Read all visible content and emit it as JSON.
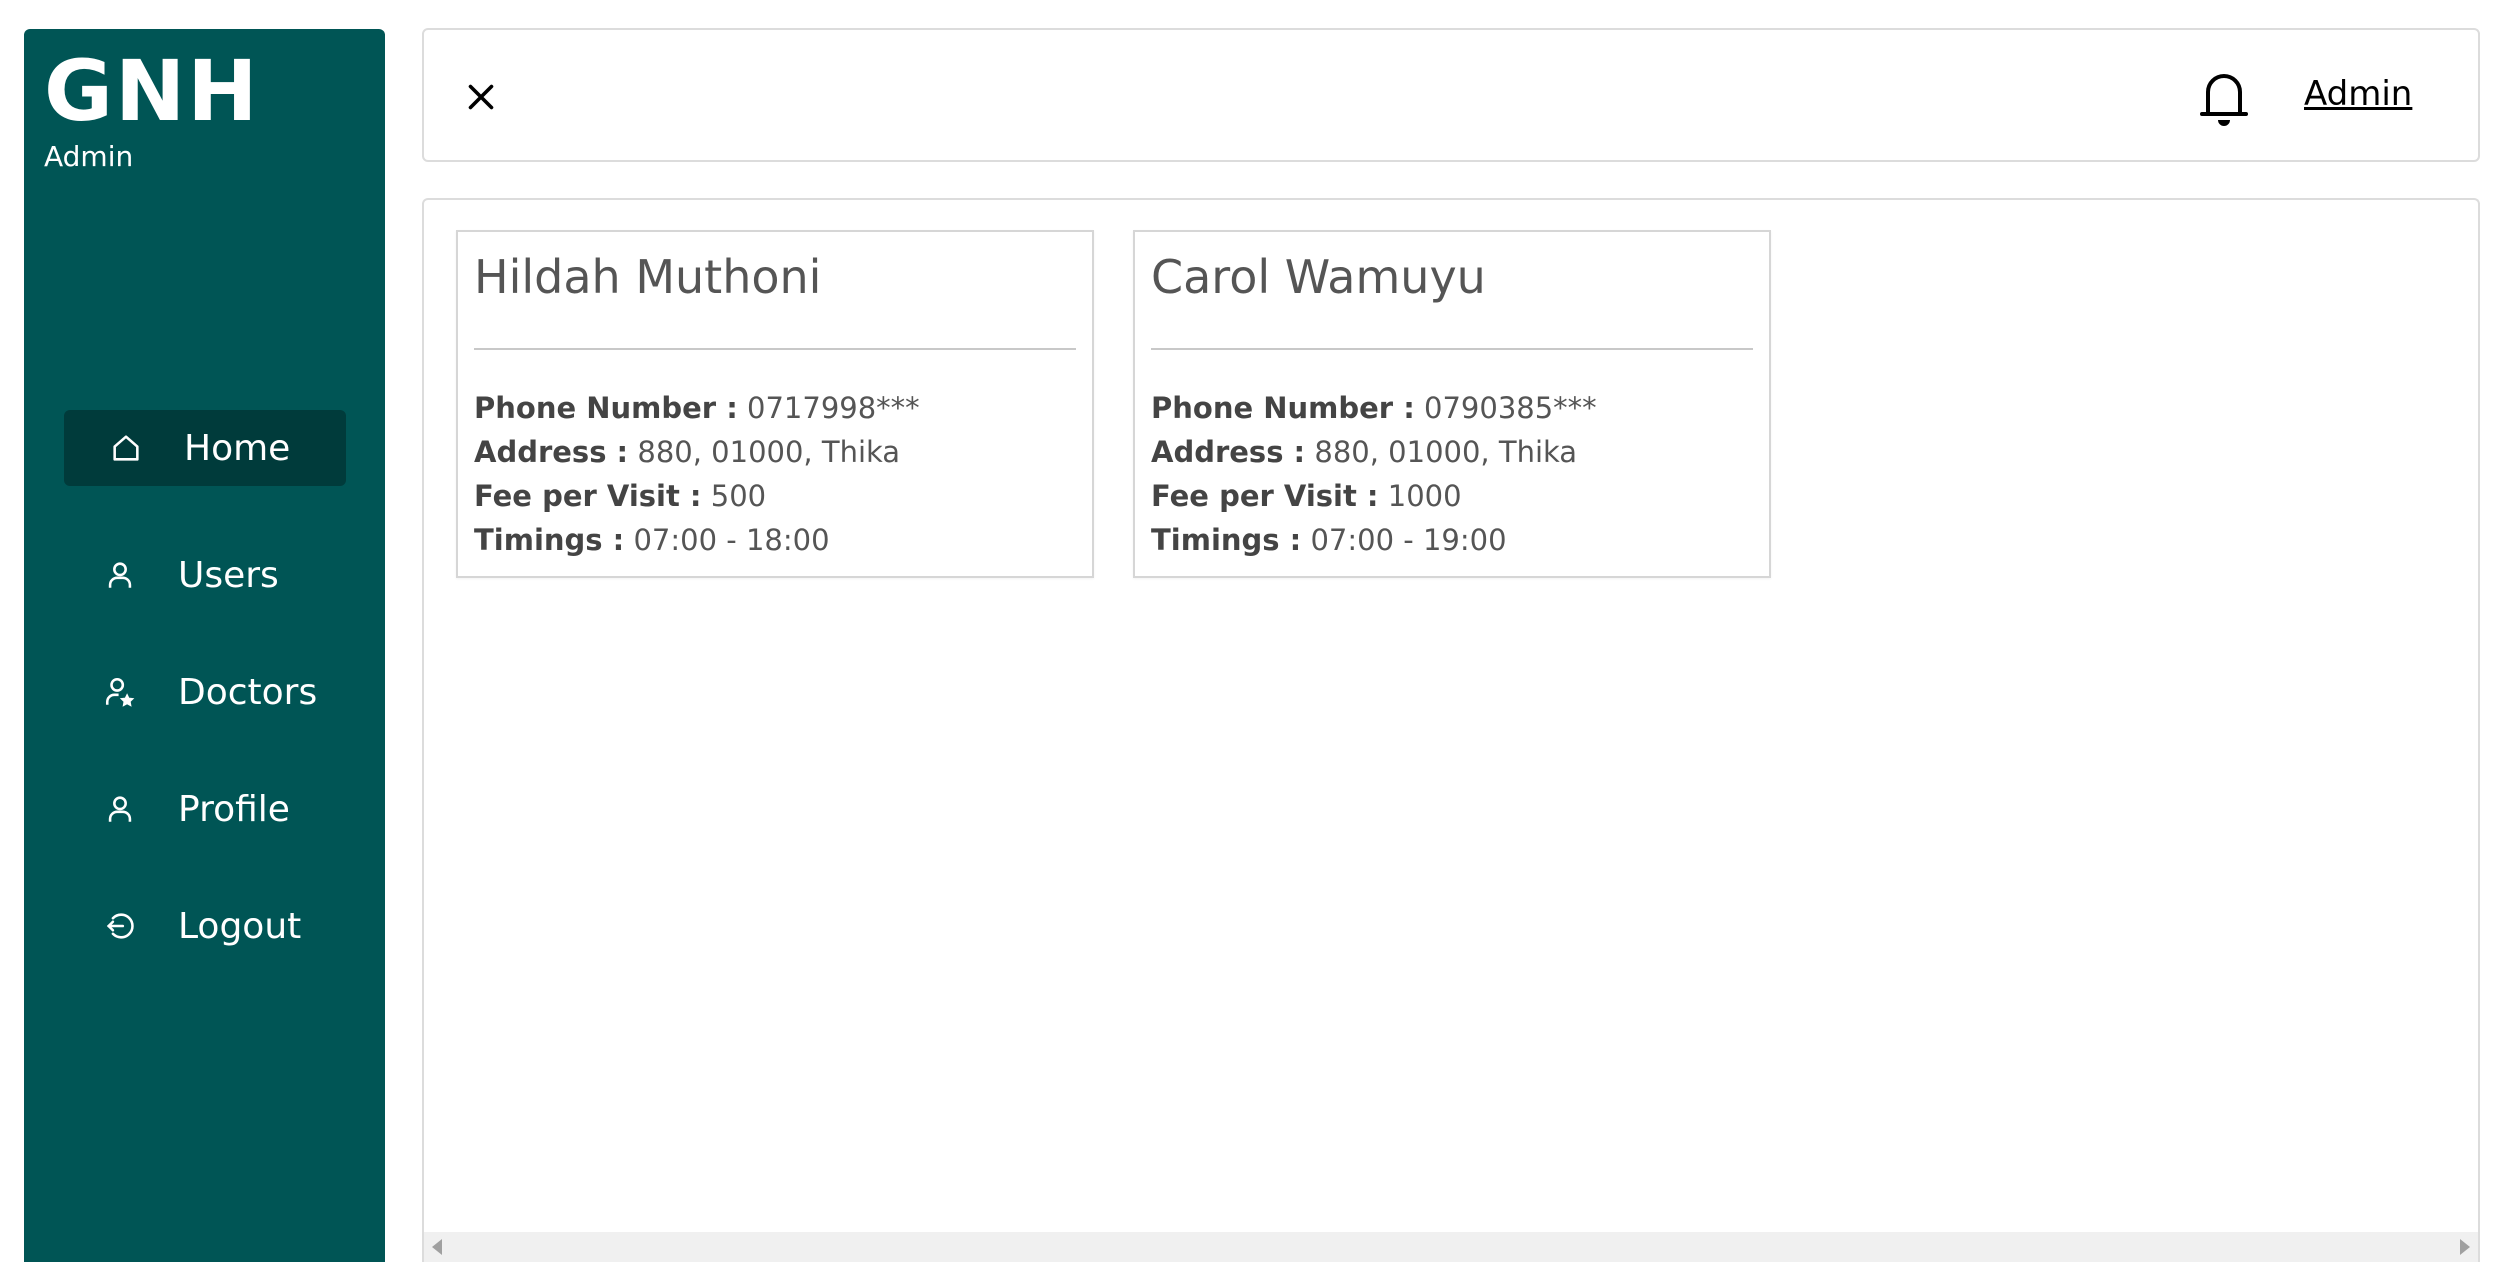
{
  "sidebar": {
    "brand": "GNH",
    "role": "Admin",
    "items": [
      {
        "label": "Home",
        "icon": "home-icon",
        "active": true
      },
      {
        "label": "Users",
        "icon": "user-icon",
        "active": false
      },
      {
        "label": "Doctors",
        "icon": "doctor-icon",
        "active": false
      },
      {
        "label": "Profile",
        "icon": "user-icon",
        "active": false
      },
      {
        "label": "Logout",
        "icon": "logout-icon",
        "active": false
      }
    ]
  },
  "topbar": {
    "close_icon": "close-icon",
    "bell_icon": "bell-icon",
    "user_link": "Admin"
  },
  "labels": {
    "phone": "Phone Number :",
    "address": "Address :",
    "fee": "Fee per Visit :",
    "timings": "Timings :"
  },
  "doctors": [
    {
      "name": "Hildah Muthoni",
      "phone": "0717998***",
      "address": "880, 01000, Thika",
      "fee": "500",
      "timings": "07:00 - 18:00"
    },
    {
      "name": "Carol Wamuyu",
      "phone": "0790385***",
      "address": "880, 01000, Thika",
      "fee": "1000",
      "timings": "07:00 - 19:00"
    }
  ],
  "colors": {
    "sidebar_bg": "#005555",
    "active_item_bg": "#003b3b",
    "text_muted": "#555555"
  }
}
